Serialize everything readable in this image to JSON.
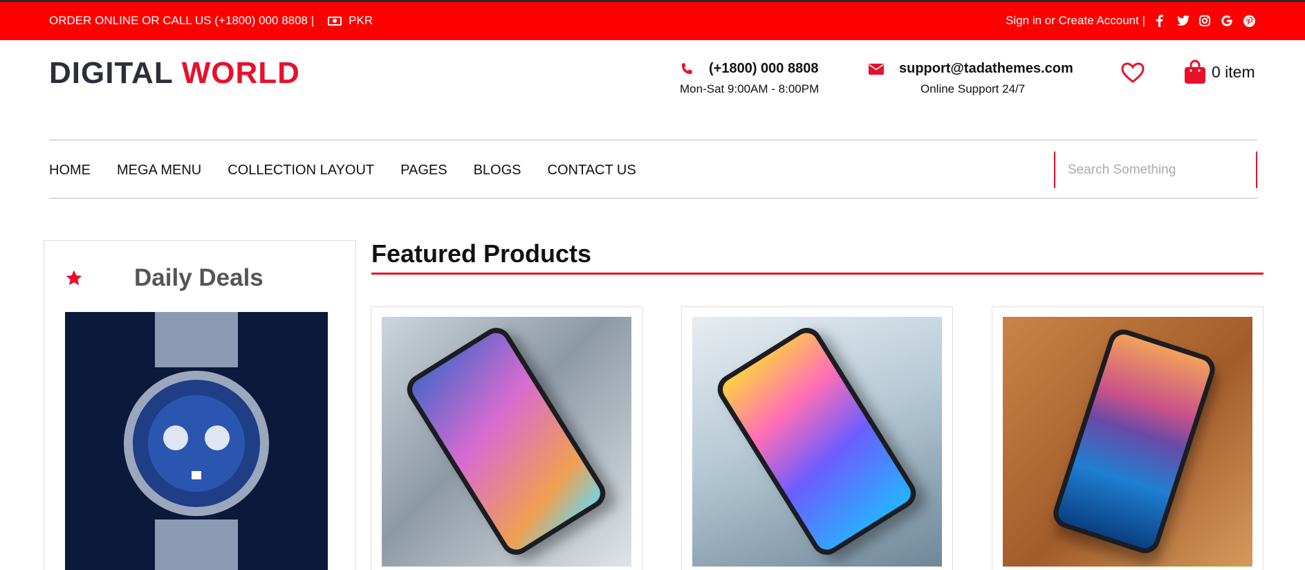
{
  "topbar": {
    "order_text": "ORDER ONLINE OR CALL US (+1800) 000 8808 |",
    "currency": "PKR",
    "account_text": "Sign in or Create Account |",
    "socials": [
      "facebook-icon",
      "twitter-icon",
      "instagram-icon",
      "google-icon",
      "pinterest-icon"
    ]
  },
  "header": {
    "logo_part1": "DIGITAL",
    "logo_part2": "WORLD",
    "phone": "(+1800) 000 8808",
    "phone_hours": "Mon-Sat 9:00AM - 8:00PM",
    "email": "support@tadathemes.com",
    "email_sub": "Online Support 24/7",
    "cart_label": "0 item"
  },
  "nav": {
    "items": [
      "HOME",
      "MEGA MENU",
      "COLLECTION LAYOUT",
      "PAGES",
      "BLOGS",
      "CONTACT US"
    ],
    "search_placeholder": "Search Something"
  },
  "deals": {
    "title": "Daily Deals"
  },
  "featured": {
    "title": "Featured Products"
  },
  "colors": {
    "accent": "#ff0000",
    "brand_red": "#e8102a",
    "logo_dark": "#2a2f3a"
  }
}
